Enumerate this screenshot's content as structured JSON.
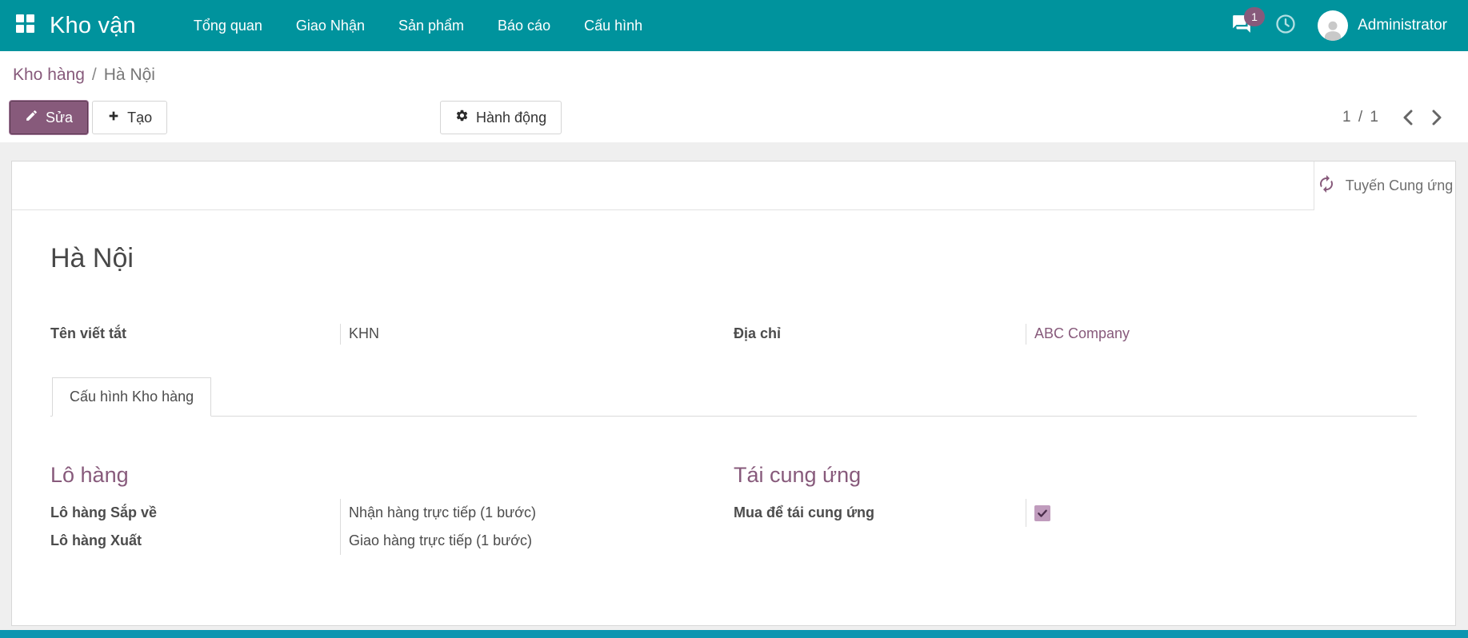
{
  "colors": {
    "nav_teal": "#00939d",
    "accent_purple": "#875a7b",
    "bottom_strip": "#0d95b0"
  },
  "nav": {
    "brand": "Kho vận",
    "items": [
      {
        "label": "Tổng quan"
      },
      {
        "label": "Giao Nhận"
      },
      {
        "label": "Sản phẩm"
      },
      {
        "label": "Báo cáo"
      },
      {
        "label": "Cấu hình"
      }
    ],
    "messages_badge": "1",
    "user": "Administrator"
  },
  "breadcrumb": {
    "parent": "Kho hàng",
    "separator": "/",
    "current": "Hà Nội"
  },
  "control_panel": {
    "edit": "Sửa",
    "create": "Tạo",
    "action": "Hành động",
    "pager": "1 / 1"
  },
  "form": {
    "stat_button": "Tuyến Cung ứng",
    "title": "Hà Nội",
    "short_name_label": "Tên viết tắt",
    "short_name_value": "KHN",
    "address_label": "Địa chỉ",
    "address_value": "ABC Company",
    "tab": "Cấu hình Kho hàng",
    "shipments": {
      "title": "Lô hàng",
      "rows": [
        {
          "label": "Lô hàng Sắp về",
          "value": "Nhận hàng trực tiếp (1 bước)"
        },
        {
          "label": "Lô hàng Xuất",
          "value": "Giao hàng trực tiếp (1 bước)"
        }
      ]
    },
    "resupply": {
      "title": "Tái cung ứng",
      "buy_label": "Mua để tái cung ứng",
      "buy_checked": true
    }
  }
}
